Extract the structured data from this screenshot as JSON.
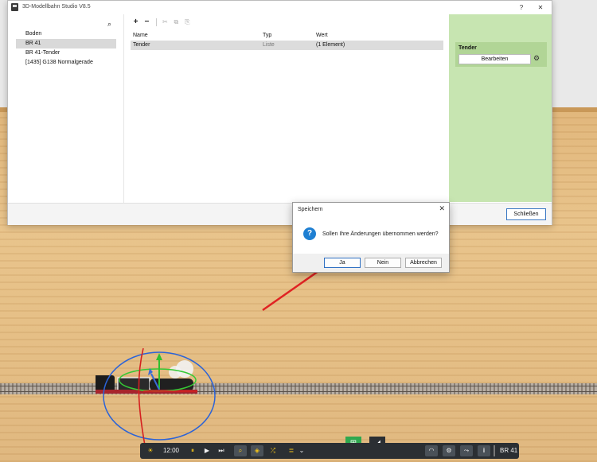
{
  "window": {
    "title": "3D-Modellbahn Studio V8.5",
    "help_glyph": "?",
    "close_glyph": "✕"
  },
  "tree": {
    "search_glyph": "⌕",
    "items": [
      {
        "label": "Boden",
        "selected": false
      },
      {
        "label": "BR 41",
        "selected": true
      },
      {
        "label": "BR 41-Tender",
        "selected": false
      },
      {
        "label": "[1435] G138 Normalgerade",
        "selected": false
      }
    ]
  },
  "toolbar": {
    "add_glyph": "+",
    "remove_glyph": "−",
    "cut_glyph": "✂",
    "copy_glyph": "⧉",
    "paste_glyph": "⎘"
  },
  "properties": {
    "headers": {
      "name": "Name",
      "type": "Typ",
      "value": "Wert"
    },
    "rows": [
      {
        "name": "Tender",
        "type": "Liste",
        "value": "(1 Element)"
      }
    ]
  },
  "right_panel": {
    "title": "Tender",
    "edit_label": "Bearbeiten",
    "gear_glyph": "⚙",
    "bg_color": "#c7e5b1"
  },
  "footer": {
    "close_label": "Schließen"
  },
  "dialog": {
    "title": "Speichern",
    "close_glyph": "✕",
    "icon_glyph": "?",
    "message": "Sollen Ihre Änderungen übernommen werden?",
    "buttons": {
      "yes": "Ja",
      "no": "Nein",
      "cancel": "Abbrechen"
    }
  },
  "bottom_toolbar": {
    "sun_glyph": "☀",
    "time": "12:00",
    "pause_glyph": "⏸",
    "play_glyph": "▶",
    "step_glyph": "⏭",
    "search_glyph": "⌕",
    "layers_glyph": "◈",
    "shuffle_glyph": "⤮",
    "list_glyph": "≣",
    "chevron_glyph": "⌄",
    "speed_glyph": "◠",
    "settings_glyph": "⚙",
    "route_glyph": "⤳",
    "info_glyph": "i",
    "selected_object": "BR 41",
    "grid_tab_glyph": "⊞",
    "terrain_tab_glyph": "◢",
    "tab_color": "#2fa84f"
  }
}
